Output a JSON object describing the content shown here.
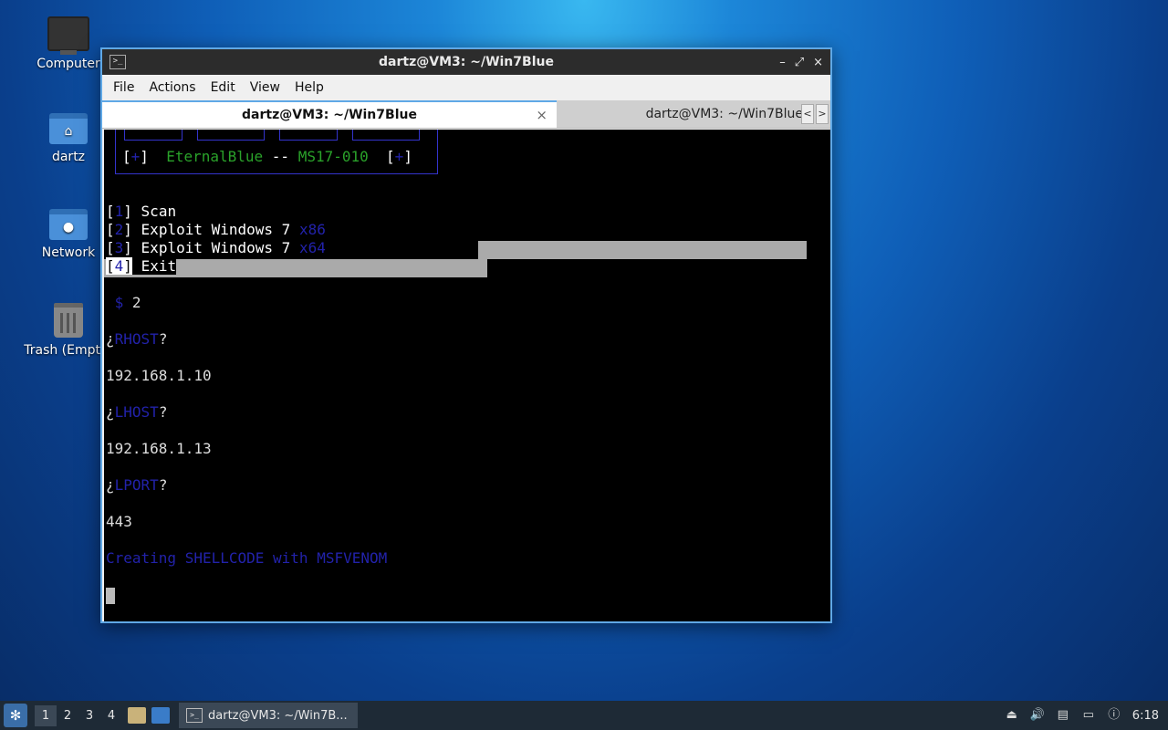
{
  "desktop": {
    "icons": [
      {
        "label": "Computer",
        "icon": "computer-icon"
      },
      {
        "label": "dartz",
        "icon": "home-folder-icon"
      },
      {
        "label": "Network",
        "icon": "network-folder-icon"
      },
      {
        "label": "Trash (Empty)",
        "icon": "trash-icon"
      }
    ]
  },
  "window": {
    "title": "dartz@VM3: ~/Win7Blue",
    "controls": {
      "minimize": "–",
      "maximize": "⤢",
      "close": "×"
    },
    "menu": [
      "File",
      "Actions",
      "Edit",
      "View",
      "Help"
    ],
    "tabs": [
      {
        "label": "dartz@VM3: ~/Win7Blue",
        "close": "×"
      },
      {
        "label": "dartz@VM3: ~/Win7Blue"
      }
    ],
    "tab_nav": {
      "left": "<",
      "right": ">"
    }
  },
  "terminal": {
    "banner": {
      "open": "[",
      "plus": "+",
      "close": "]",
      "name": "EternalBlue",
      "sep": "--",
      "code": "MS17-010"
    },
    "menu_items": [
      {
        "num": "1",
        "text": "Scan",
        "arch": ""
      },
      {
        "num": "2",
        "text": "Exploit Windows 7",
        "arch": "x86"
      },
      {
        "num": "3",
        "text": "Exploit Windows 7",
        "arch": "x64"
      },
      {
        "num": "4",
        "text": "Exit",
        "arch": ""
      }
    ],
    "prompt_symbol": "$",
    "choice": "2",
    "q1": "RHOST",
    "a1": "192.168.1.10",
    "q2": "LHOST",
    "a2": "192.168.1.13",
    "q3": "LPORT",
    "a3": "443",
    "status": "Creating SHELLCODE with MSFVENOM"
  },
  "taskbar": {
    "workspaces": [
      "1",
      "2",
      "3",
      "4"
    ],
    "task_label": "dartz@VM3: ~/Win7B...",
    "clock": "6:18"
  }
}
